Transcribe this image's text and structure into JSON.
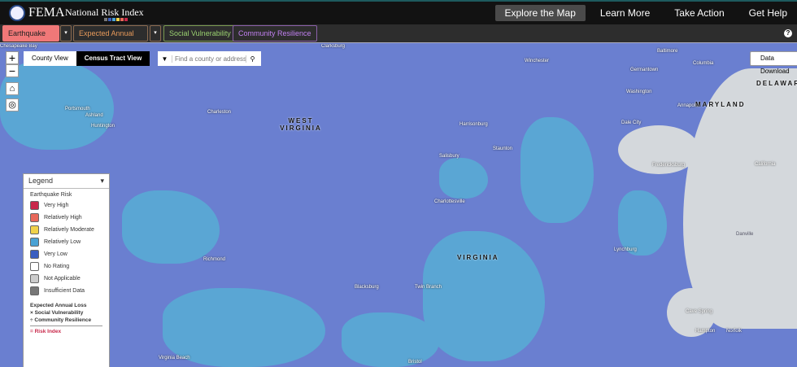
{
  "header": {
    "logo_text": "FEMA",
    "app_title": "National Risk Index",
    "nav": [
      "Explore the Map",
      "Learn More",
      "Take Action",
      "Get Help"
    ],
    "active_nav": "Explore the Map"
  },
  "filters": {
    "risk": "Earthquake (RI)",
    "eal": "Expected Annual Loss",
    "sv": "Social Vulnerability",
    "cr": "Community Resilience",
    "caret": "▾",
    "help": "?"
  },
  "map": {
    "zoom_in": "+",
    "zoom_out": "−",
    "home_icon": "⌂",
    "locate_icon": "◎",
    "views": [
      "County View",
      "Census Tract View"
    ],
    "selected_view": "Census Tract View",
    "search_placeholder": "Find a county or address",
    "search_icon": "⚲",
    "dropdown": "▼",
    "data_download": "Data Download",
    "labels": [
      {
        "t": "Clarksburg"
      },
      {
        "t": "Winchester"
      },
      {
        "t": "Germantown"
      },
      {
        "t": "Columbia"
      },
      {
        "t": "Baltimore"
      },
      {
        "t": "Washington"
      },
      {
        "t": "Annapolis"
      },
      {
        "t": "Portsmouth"
      },
      {
        "t": "Huntington"
      },
      {
        "t": "Ashland"
      },
      {
        "t": "Charleston"
      },
      {
        "t": "Harrisonburg"
      },
      {
        "t": "Dale City"
      },
      {
        "t": "Fredericksburg"
      },
      {
        "t": "California"
      },
      {
        "t": "Salisbury"
      },
      {
        "t": "Staunton"
      },
      {
        "t": "Charlottesville"
      },
      {
        "t": "Lynchburg"
      },
      {
        "t": "Richmond"
      },
      {
        "t": "Twin Branch"
      },
      {
        "t": "Blacksburg"
      },
      {
        "t": "Cave Spring"
      },
      {
        "t": "Hampton"
      },
      {
        "t": "Norfolk"
      },
      {
        "t": "Virginia Beach"
      },
      {
        "t": "Bristol"
      },
      {
        "t": "Danville"
      },
      {
        "t": "Chesapeake Bay"
      }
    ],
    "states": [
      "WEST VIRGINIA",
      "VIRGINIA",
      "MARYLAND",
      "DELAWARE"
    ]
  },
  "legend": {
    "title": "Legend",
    "subtitle": "Earthquake Risk",
    "items": [
      {
        "label": "Very High",
        "color": "#c8284a"
      },
      {
        "label": "Relatively High",
        "color": "#e8685a"
      },
      {
        "label": "Relatively Moderate",
        "color": "#f0d24a"
      },
      {
        "label": "Relatively Low",
        "color": "#4aa2d4"
      },
      {
        "label": "Very Low",
        "color": "#3a5ec0"
      },
      {
        "label": "No Rating",
        "color": "#ffffff"
      },
      {
        "label": "Not Applicable",
        "color": "#cccccc"
      },
      {
        "label": "Insufficient Data",
        "color": "#777777"
      }
    ],
    "formula": [
      "Expected Annual Loss",
      "× Social Vulnerability",
      "÷ Community Resilience",
      "= Risk Index"
    ]
  }
}
